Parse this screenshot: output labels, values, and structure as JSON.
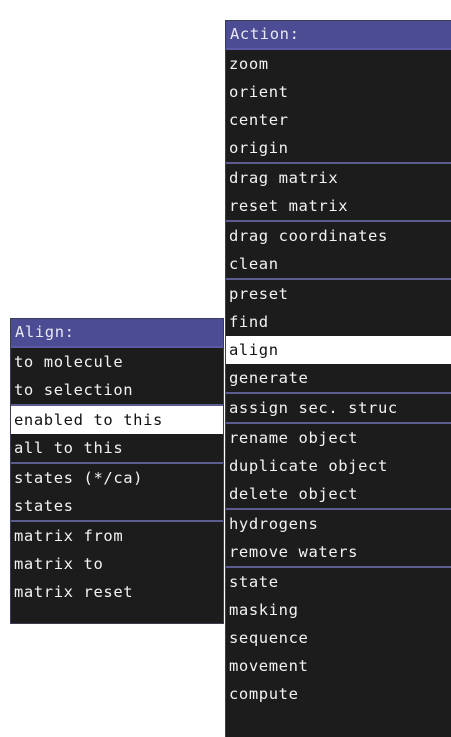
{
  "action_menu": {
    "title": "Action:",
    "groups": [
      [
        "zoom",
        "orient",
        "center",
        "origin"
      ],
      [
        "drag matrix",
        "reset matrix"
      ],
      [
        "drag coordinates",
        "clean"
      ],
      [
        "preset",
        "find",
        "align",
        "generate"
      ],
      [
        "assign sec. struc"
      ],
      [
        "rename object",
        "duplicate object",
        "delete object"
      ],
      [
        "hydrogens",
        "remove waters"
      ],
      [
        "state",
        "masking",
        "sequence",
        "movement",
        "compute"
      ]
    ],
    "selected": "align"
  },
  "align_menu": {
    "title": "Align:",
    "groups": [
      [
        "to molecule",
        "to selection"
      ],
      [
        "enabled to this",
        "all to this"
      ],
      [
        "states (*/ca)",
        "states"
      ],
      [
        "matrix from",
        "matrix to",
        "matrix reset"
      ]
    ],
    "selected": "enabled to this"
  },
  "colors": {
    "title_bg": "#4c4c94",
    "menu_bg": "#1c1c1c",
    "separator": "#5c5c90",
    "highlight_bg": "#ffffff"
  }
}
